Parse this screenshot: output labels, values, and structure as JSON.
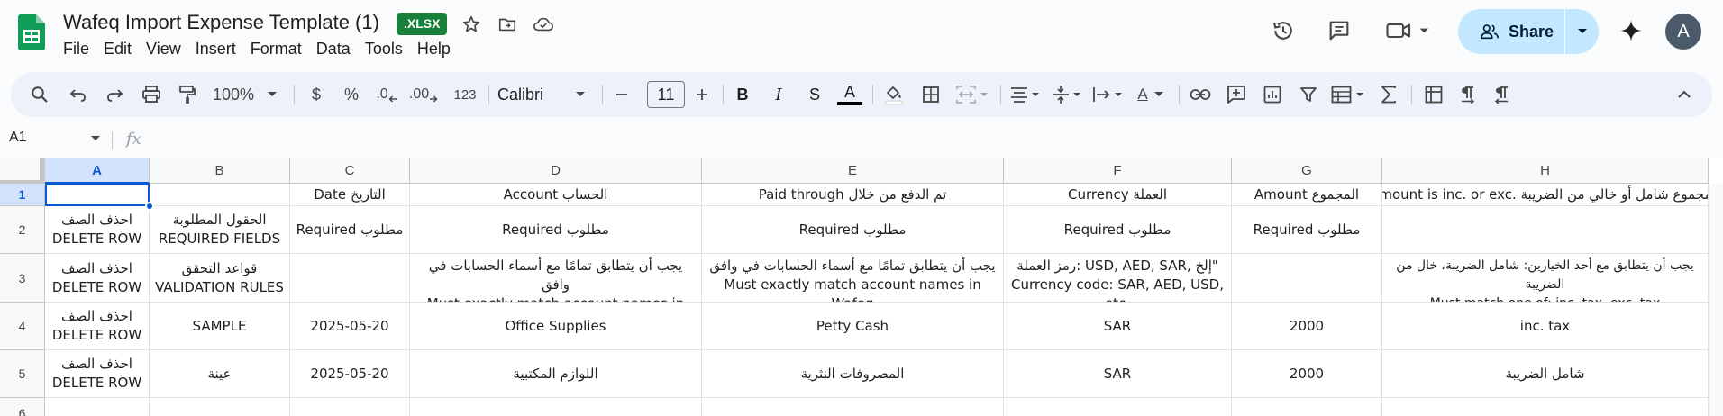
{
  "doc": {
    "title": "Wafeq Import Expense Template (1)",
    "badge": ".XLSX"
  },
  "menu": [
    "File",
    "Edit",
    "View",
    "Insert",
    "Format",
    "Data",
    "Tools",
    "Help"
  ],
  "share": {
    "label": "Share"
  },
  "user": {
    "avatar_letter": "A"
  },
  "toolbar": {
    "zoom": "100%",
    "currency": "$",
    "percent": "%",
    "dec_decrease": ".0",
    "dec_increase": ".00",
    "number_format": "123",
    "font_family": "Calibri",
    "font_size": "11",
    "bold": "B",
    "italic": "I",
    "strike": "S",
    "text_color": "A",
    "text_color_bar": "#000000",
    "rotation_icon": "A"
  },
  "formula_bar": {
    "cell_ref": "A1",
    "fx": "fx"
  },
  "grid": {
    "columns": [
      "A",
      "B",
      "C",
      "D",
      "E",
      "F",
      "G",
      "H"
    ],
    "rows": [
      "1",
      "2",
      "3",
      "4",
      "5",
      "6"
    ],
    "cells": [
      [
        "",
        "",
        "Date التاريخ",
        "Account الحساب",
        "Paid through تم الدفع من خلال",
        "Currency العملة",
        "Amount المجموع",
        "Amount is inc. or exc. المجموع شامل أو خالي من الضريبة"
      ],
      [
        "احذف الصف\nDELETE ROW",
        "الحقول المطلوبة\nREQUIRED FIELDS",
        "Required مطلوب",
        "Required مطلوب",
        "Required مطلوب",
        "Required مطلوب",
        "Required مطلوب",
        ""
      ],
      [
        "احذف الصف\nDELETE ROW",
        "قواعد التحقق\nVALIDATION RULES",
        "",
        "يجب أن يتطابق تمامًا مع أسماء الحسابات في وافق\nMust exactly match account names in Wafeq",
        "يجب أن يتطابق تمامًا مع أسماء الحسابات في وافق\nMust exactly match account names in Wafeq",
        "رمز العملة: USD, AED, SAR, إلخ\"\nCurrency code: SAR, AED, USD, etc.",
        "",
        "يجب أن يتطابق مع أحد الخيارين: شامل الضريبة، خال من الضريبة\nMust match one of: inc. tax, exc. tax"
      ],
      [
        "احذف الصف\nDELETE ROW",
        "SAMPLE",
        "2025-05-20",
        "Office Supplies",
        "Petty Cash",
        "SAR",
        "2000",
        "inc. tax"
      ],
      [
        "احذف الصف\nDELETE ROW",
        "عينة",
        "2025-05-20",
        "اللوازم المكتبية",
        "المصروفات النثرية",
        "SAR",
        "2000",
        "شامل الضريبة"
      ],
      [
        "",
        "",
        "",
        "",
        "",
        "",
        "",
        ""
      ]
    ]
  }
}
